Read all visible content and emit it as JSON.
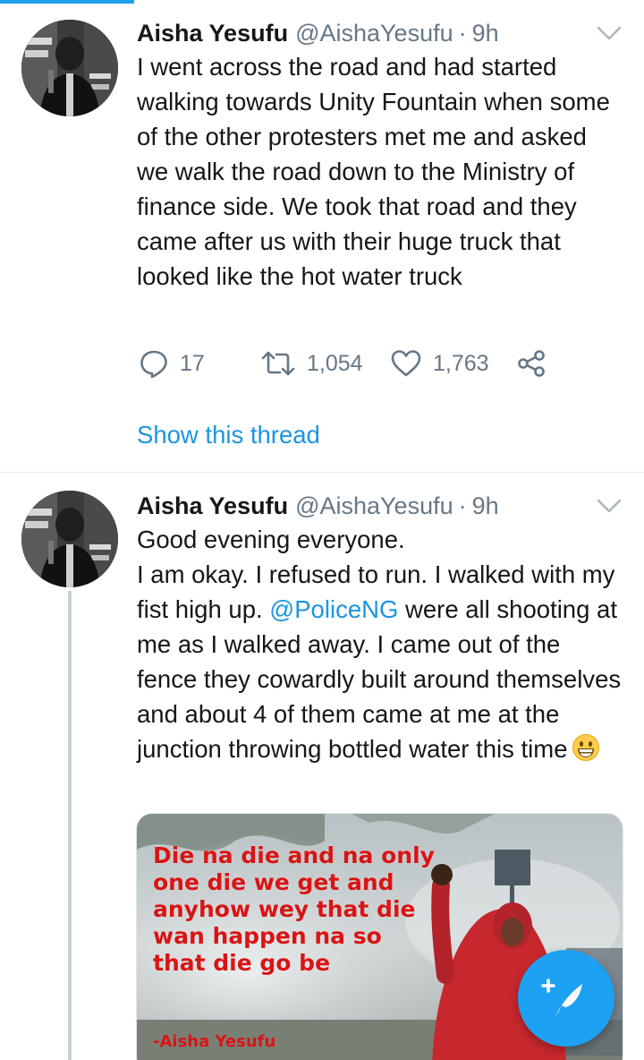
{
  "accent_color": "#1da1f2",
  "link_color": "#1b95e0",
  "tweets": [
    {
      "display_name": "Aisha Yesufu",
      "handle": "@AishaYesufu",
      "separator": "·",
      "time": "9h",
      "text": "I went across the road and had started walking towards Unity Fountain when some of the other protesters met me and asked we walk the road down to the Ministry of finance side. We took that road and they came after us with their huge truck that looked like the hot water truck",
      "replies": "17",
      "retweets": "1,054",
      "likes": "1,763",
      "show_thread": "Show this thread",
      "icons": [
        "reply-icon",
        "retweet-icon",
        "like-icon",
        "share-icon",
        "chevron-down-icon"
      ]
    },
    {
      "display_name": "Aisha Yesufu",
      "handle": "@AishaYesufu",
      "separator": "·",
      "time": "9h",
      "text_before_mention": "Good evening everyone.\nI am okay. I refused to run. I walked with my fist high up. ",
      "mention": "@PoliceNG",
      "text_after_mention": " were all shooting at me as I walked away. I came out of the fence they cowardly built around themselves and about 4 of them came at me at the junction throwing bottled water this time",
      "emoji": "grinning-face-emoji",
      "media": {
        "quote": "Die na die and na only one die we get and anyhow wey that die wan happen na so that die go be",
        "author": "-Aisha Yesufu"
      }
    }
  ],
  "fab": {
    "icon": "compose-tweet-icon"
  }
}
